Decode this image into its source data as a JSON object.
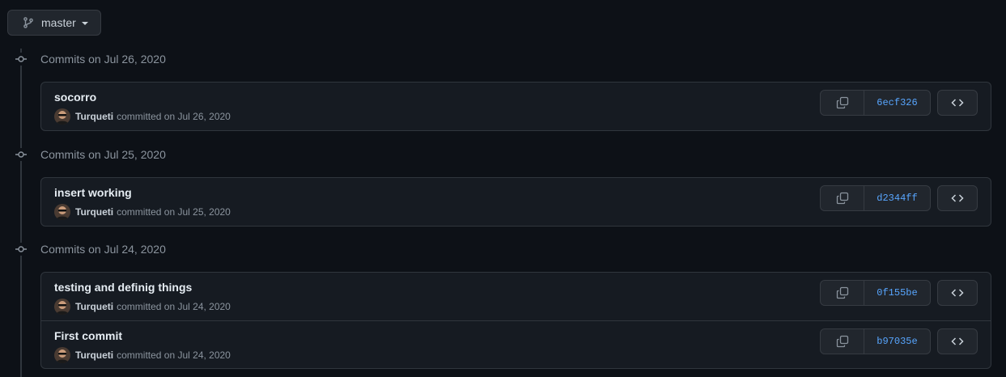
{
  "branch": {
    "name": "master",
    "icon": "git-branch-icon"
  },
  "groups": [
    {
      "header": "Commits on Jul 26, 2020",
      "commits": [
        {
          "title": "socorro",
          "author": "Turqueti",
          "date_text": "committed on Jul 26, 2020",
          "sha": "6ecf326"
        }
      ]
    },
    {
      "header": "Commits on Jul 25, 2020",
      "commits": [
        {
          "title": "insert working",
          "author": "Turqueti",
          "date_text": "committed on Jul 25, 2020",
          "sha": "d2344ff"
        }
      ]
    },
    {
      "header": "Commits on Jul 24, 2020",
      "commits": [
        {
          "title": "testing and definig things",
          "author": "Turqueti",
          "date_text": "committed on Jul 24, 2020",
          "sha": "0f155be"
        },
        {
          "title": "First commit",
          "author": "Turqueti",
          "date_text": "committed on Jul 24, 2020",
          "sha": "b97035e"
        }
      ]
    }
  ],
  "colors": {
    "background": "#0d1117",
    "sha_link": "#58a6ff",
    "border": "#30363d"
  }
}
